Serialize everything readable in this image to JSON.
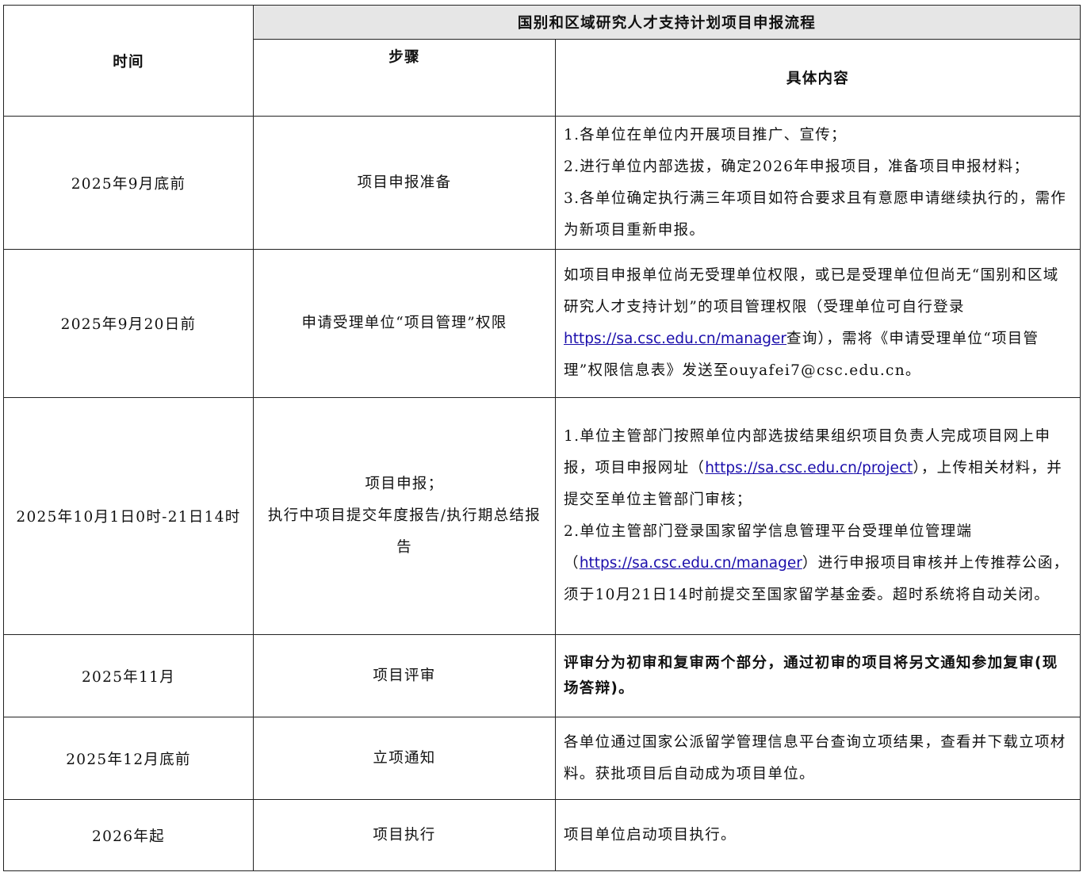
{
  "table": {
    "title": "国别和区域研究人才支持计划项目申报流程",
    "headers": {
      "time": "时间",
      "step": "步骤",
      "detail": "具体内容"
    },
    "rows": [
      {
        "time": "2025年9月底前",
        "step": [
          "项目申报准备"
        ],
        "detail": [
          "1.各单位在单位内开展项目推广、宣传；",
          "2.进行单位内部选拔，确定2026年申报项目，准备项目申报材料；",
          "3.各单位确定执行满三年项目如符合要求且有意愿申请继续执行的，需作为新项目重新申报。"
        ]
      },
      {
        "time": "2025年9月20日前",
        "step": [
          "申请受理单位“项目管理”权限"
        ],
        "detail_a": "如项目申报单位尚无受理单位权限，或已是受理单位但尚无“国别和区域研究人才支持计划”的项目管理权限（受理单位可自行登录",
        "detail_link": "https://sa.csc.edu.cn/manager",
        "detail_b": "查询），需将《申请受理单位“项目管理”权限信息表》发送至ouyafei7@csc.edu.cn。"
      },
      {
        "time": "2025年10月1日0时-21日14时",
        "step": [
          "项目申报；",
          "执行中项目提交年度报告/执行期总结报告"
        ],
        "detail_1a": "1.单位主管部门按照单位内部选拔结果组织项目负责人完成项目网上申报，项目申报网址（",
        "detail_1_link": "https://sa.csc.edu.cn/project",
        "detail_1b": "），上传相关材料，并提交至单位主管部门审核；",
        "detail_2a": "2.单位主管部门登录国家留学信息管理平台受理单位管理端（",
        "detail_2_link": "https://sa.csc.edu.cn/manager",
        "detail_2b": "）进行申报项目审核并上传推荐公函，须于10月21日14时前提交至国家留学基金委。超时系统将自动关闭。"
      },
      {
        "time": "2025年11月",
        "step": [
          "项目评审"
        ],
        "detail": [
          "评审分为初审和复审两个部分，通过初审的项目将另文通知参加复审(现场答辩)。"
        ]
      },
      {
        "time": "2025年12月底前",
        "step": [
          "立项通知"
        ],
        "detail": [
          "各单位通过国家公派留学管理信息平台查询立项结果，查看并下载立项材料。获批项目后自动成为项目单位。"
        ]
      },
      {
        "time": "2026年起",
        "step": [
          "项目执行"
        ],
        "detail": [
          "项目单位启动项目执行。"
        ]
      }
    ]
  }
}
